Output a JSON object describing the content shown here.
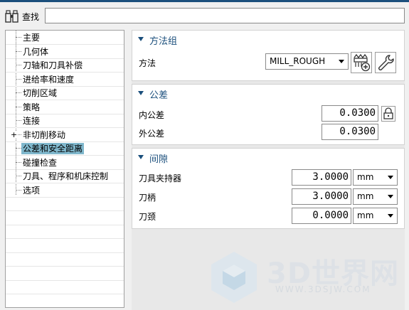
{
  "search": {
    "label": "查找",
    "value": ""
  },
  "tree": {
    "items": [
      {
        "label": "主要"
      },
      {
        "label": "几何体"
      },
      {
        "label": "刀轴和刀具补偿"
      },
      {
        "label": "进给率和速度"
      },
      {
        "label": "切削区域"
      },
      {
        "label": "策略"
      },
      {
        "label": "连接"
      },
      {
        "label": "非切削移动",
        "expander": "+"
      },
      {
        "label": "公差和安全距离",
        "selected": true
      },
      {
        "label": "碰撞检查"
      },
      {
        "label": "刀具、程序和机床控制"
      },
      {
        "label": "选项"
      }
    ]
  },
  "method_group": {
    "title": "方法组",
    "method_label": "方法",
    "method_value": "MILL_ROUGH",
    "create_icon": "create-method-icon",
    "edit_icon": "wrench-icon"
  },
  "tolerance": {
    "title": "公差",
    "inner_label": "内公差",
    "inner_value": "0.0300",
    "outer_label": "外公差",
    "outer_value": "0.0300",
    "lock_icon": "lock-icon"
  },
  "clearance": {
    "title": "间隙",
    "rows": [
      {
        "label": "刀具夹持器",
        "value": "3.0000",
        "unit": "mm"
      },
      {
        "label": "刀柄",
        "value": "3.0000",
        "unit": "mm"
      },
      {
        "label": "刀颈",
        "value": "0.0000",
        "unit": "mm"
      }
    ]
  },
  "watermark": {
    "text": "3D世界网",
    "url": "WWW.3DSJW.COM"
  },
  "colors": {
    "accent": "#1b4f7c",
    "selected": "#7fb7cc",
    "background": "#f0f0f0"
  }
}
